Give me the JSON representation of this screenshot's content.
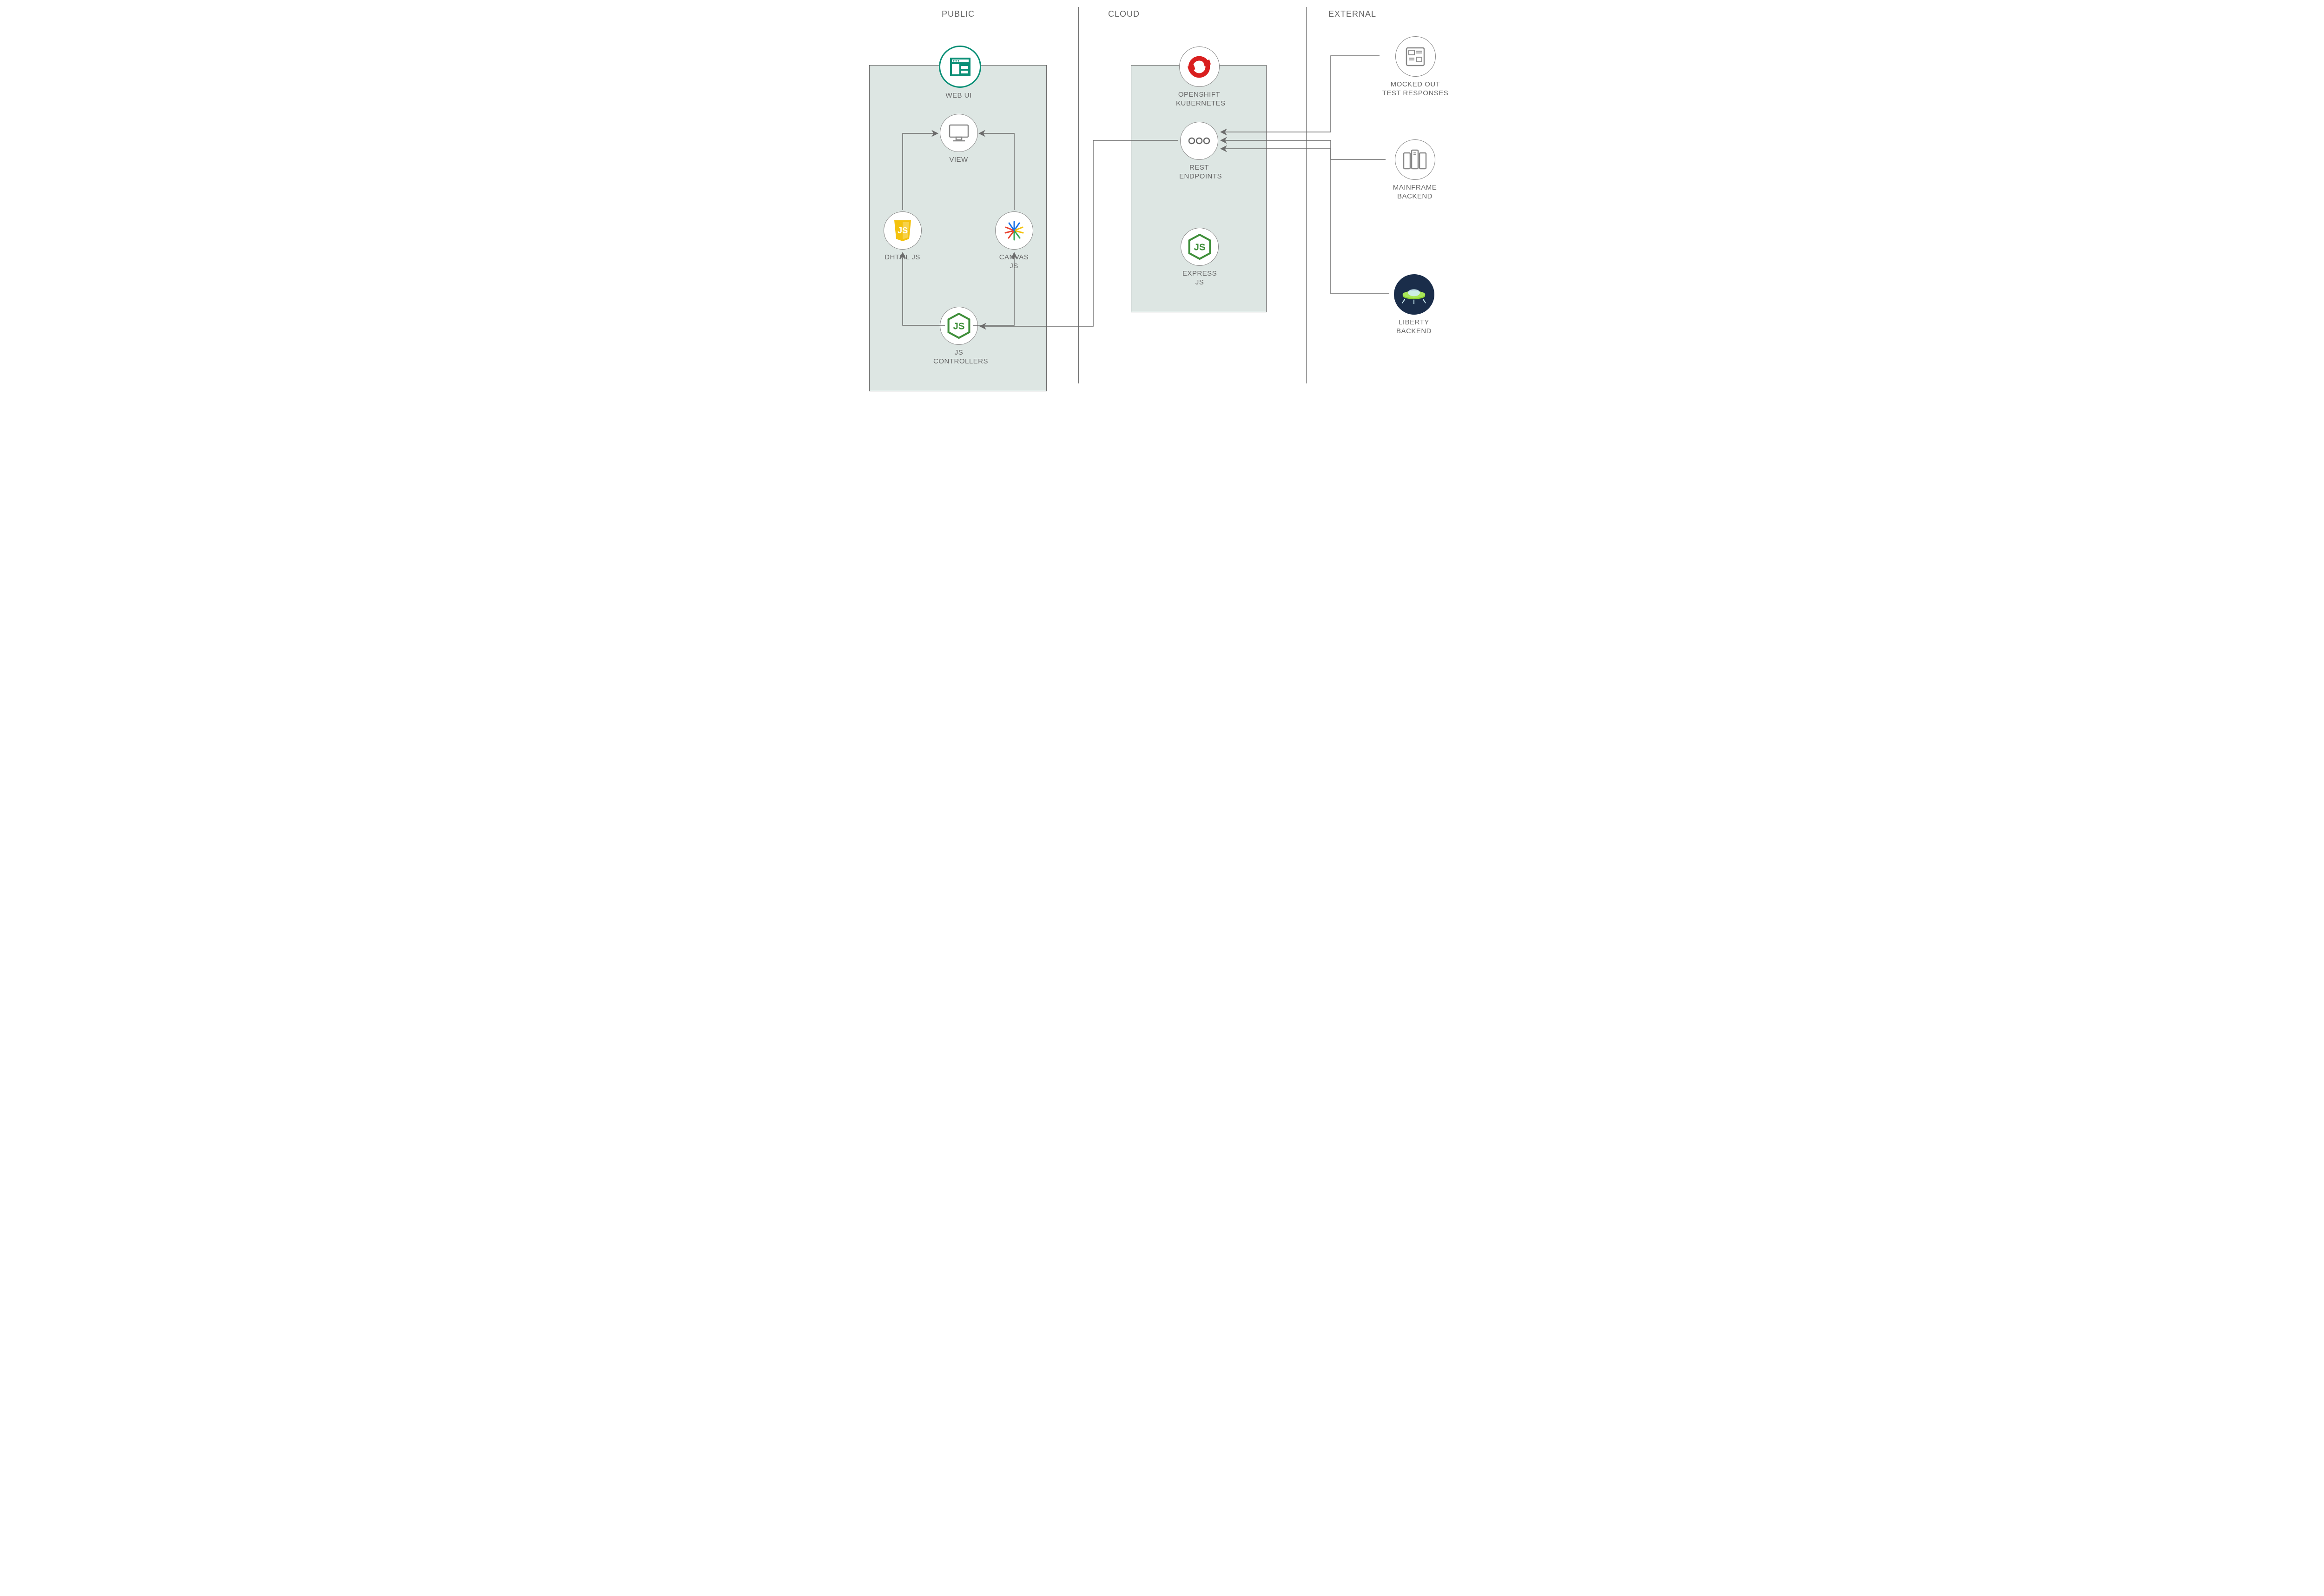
{
  "sections": {
    "public": "PUBLIC",
    "cloud": "CLOUD",
    "external": "EXTERNAL"
  },
  "nodes": {
    "webui": {
      "label": "WEB UI"
    },
    "view": {
      "label": "VIEW"
    },
    "dhtml": {
      "label": "DHTML JS"
    },
    "canvas": {
      "label": "CANVAS JS"
    },
    "jsctrl": {
      "label1": "JS",
      "label2": "CONTROLLERS"
    },
    "openshift": {
      "label1": "OPENSHIFT",
      "label2": "KUBERNETES"
    },
    "rest": {
      "label1": "REST",
      "label2": "ENDPOINTS"
    },
    "express": {
      "label": "EXPRESS JS"
    },
    "mock": {
      "label1": "MOCKED OUT",
      "label2": "TEST RESPONSES"
    },
    "mainframe": {
      "label1": "MAINFRAME",
      "label2": "BACKEND"
    },
    "liberty": {
      "label1": "LIBERTY",
      "label2": "BACKEND"
    }
  },
  "arrows": [
    {
      "from": "jsctrl",
      "to": "dhtml"
    },
    {
      "from": "jsctrl",
      "to": "canvas"
    },
    {
      "from": "dhtml",
      "to": "view"
    },
    {
      "from": "canvas",
      "to": "view"
    },
    {
      "from": "rest",
      "to": "jsctrl"
    },
    {
      "from": "mock",
      "to": "rest"
    },
    {
      "from": "mainframe",
      "to": "rest"
    },
    {
      "from": "liberty",
      "to": "rest"
    }
  ],
  "colors": {
    "boxFill": "#dde6e3",
    "stroke": "#6b6b6b",
    "teal": "#0a8f76",
    "green": "#3f8f3a",
    "yellow": "#f4c20d",
    "red": "#d91f1f",
    "navy": "#1a2d4a",
    "lime": "#8ed332"
  }
}
